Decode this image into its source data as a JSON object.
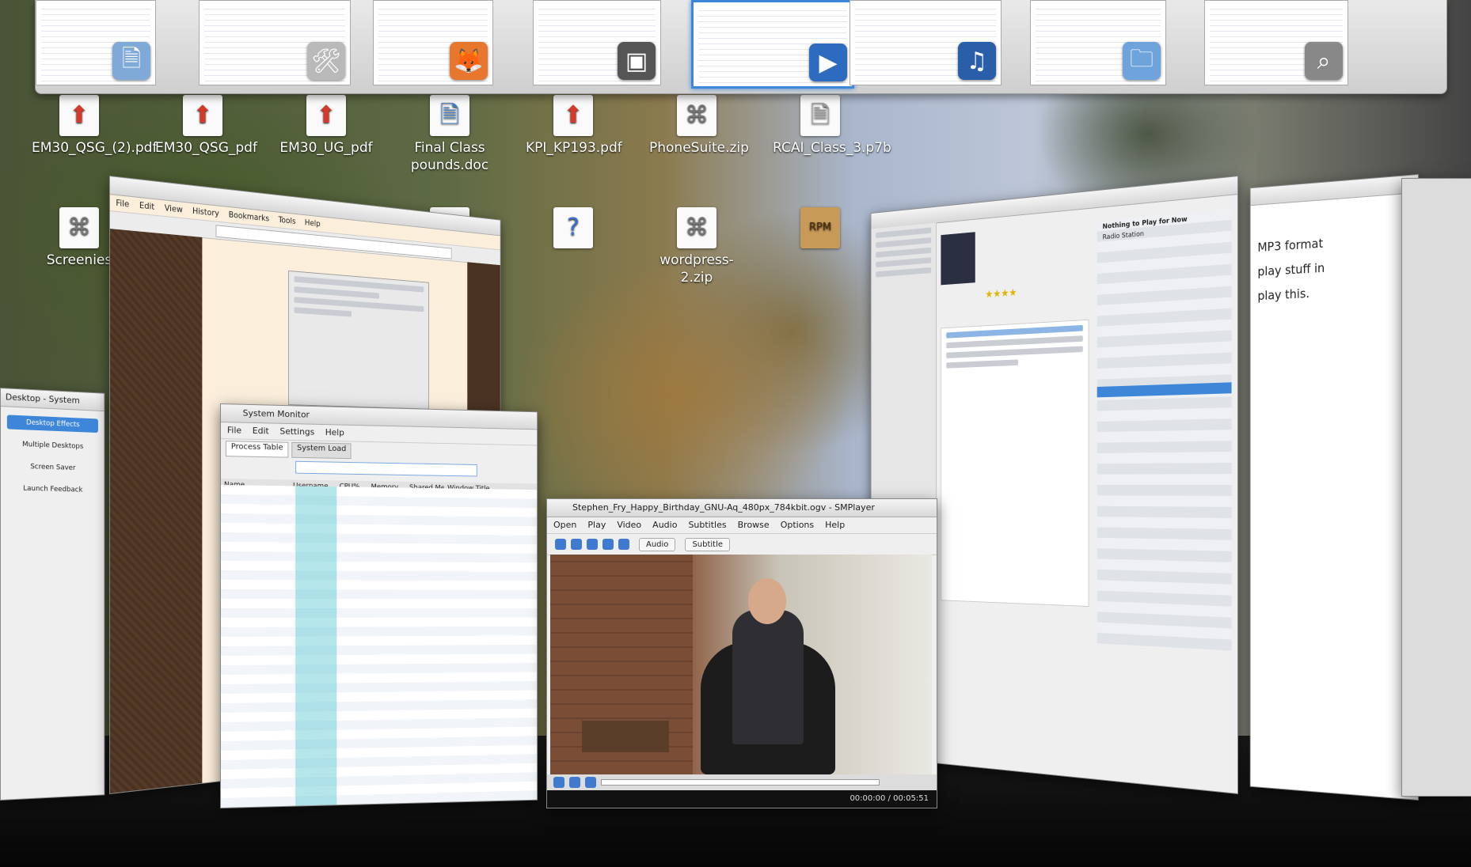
{
  "switcher": {
    "thumbs": [
      {
        "icon": "document-icon",
        "glyph": "🗎",
        "color": "#7fa9d6"
      },
      {
        "icon": "tools-icon",
        "glyph": "🛠",
        "color": "#b9b9b9"
      },
      {
        "icon": "firefox-icon",
        "glyph": "🦊",
        "color": "#e8772e"
      },
      {
        "icon": "monitor-icon",
        "glyph": "▣",
        "color": "#555555"
      },
      {
        "icon": "media-player-icon",
        "glyph": "▶",
        "color": "#2d6bbf"
      },
      {
        "icon": "music-player-icon",
        "glyph": "♫",
        "color": "#2a5ea8"
      },
      {
        "icon": "file-manager-icon",
        "glyph": "🗀",
        "color": "#6ea3db"
      },
      {
        "icon": "search-icon",
        "glyph": "⌕",
        "color": "#888888"
      }
    ]
  },
  "desktop_icons": [
    {
      "label": "EM30_QSG_(2).pdf",
      "glyph": "⬆",
      "glyph_color": "#d23b2b"
    },
    {
      "label": "EM30_QSG_pdf",
      "glyph": "⬆",
      "glyph_color": "#d23b2b"
    },
    {
      "label": "EM30_UG_pdf",
      "glyph": "⬆",
      "glyph_color": "#d23b2b"
    },
    {
      "label": "Final Class pounds.doc",
      "glyph": "🗎",
      "glyph_color": "#3d7fc9"
    },
    {
      "label": "KPI_KP193.pdf",
      "glyph": "⬆",
      "glyph_color": "#d23b2b"
    },
    {
      "label": "PhoneSuite.zip",
      "glyph": "⌘",
      "glyph_color": "#777777"
    },
    {
      "label": "RCAI_Class_3.p7b",
      "glyph": "🗎",
      "glyph_color": "#999999"
    },
    {
      "label": "Screenies",
      "glyph": "⌘",
      "glyph_color": "#777777"
    },
    {
      "label": "",
      "glyph": "🗎",
      "glyph_color": "#3d7fc9"
    },
    {
      "label": "",
      "glyph": "?",
      "glyph_color": "#3d6fd0"
    },
    {
      "label": "wordpress-2.zip",
      "glyph": "⌘",
      "glyph_color": "#777777"
    },
    {
      "label": "",
      "glyph": "RPM",
      "glyph_color": "#8a5a22"
    }
  ],
  "sidebar_window": {
    "title": "Desktop - System",
    "items": [
      "Desktop Effects",
      "Multiple Desktops",
      "Screen Saver",
      "Launch Feedback"
    ]
  },
  "browser_window": {
    "menu": [
      "File",
      "Edit",
      "View",
      "History",
      "Bookmarks",
      "Tools",
      "Help"
    ]
  },
  "monitor_window": {
    "title": "System Monitor",
    "menu": [
      "File",
      "Edit",
      "Settings",
      "Help"
    ],
    "tabs": [
      "Process Table",
      "System Load"
    ],
    "columns": [
      "Name",
      "Username",
      "CPU%",
      "Memory",
      "Shared Mem",
      "Window Title"
    ]
  },
  "player": {
    "title": "Stephen_Fry_Happy_Birthday_GNU-Aq_480px_784kbit.ogv - SMPlayer",
    "menu": [
      "Open",
      "Play",
      "Video",
      "Audio",
      "Subtitles",
      "Browse",
      "Options",
      "Help"
    ],
    "buttons": [
      "Audio",
      "Subtitle"
    ],
    "time": "00:00:00 / 00:05:51"
  },
  "music_window": {
    "header": "Nothing to Play for Now",
    "sub": "Radio Station",
    "stars": "★★★★"
  },
  "right_document": {
    "lines": [
      "MP3 format",
      "play stuff in",
      "play this."
    ]
  }
}
